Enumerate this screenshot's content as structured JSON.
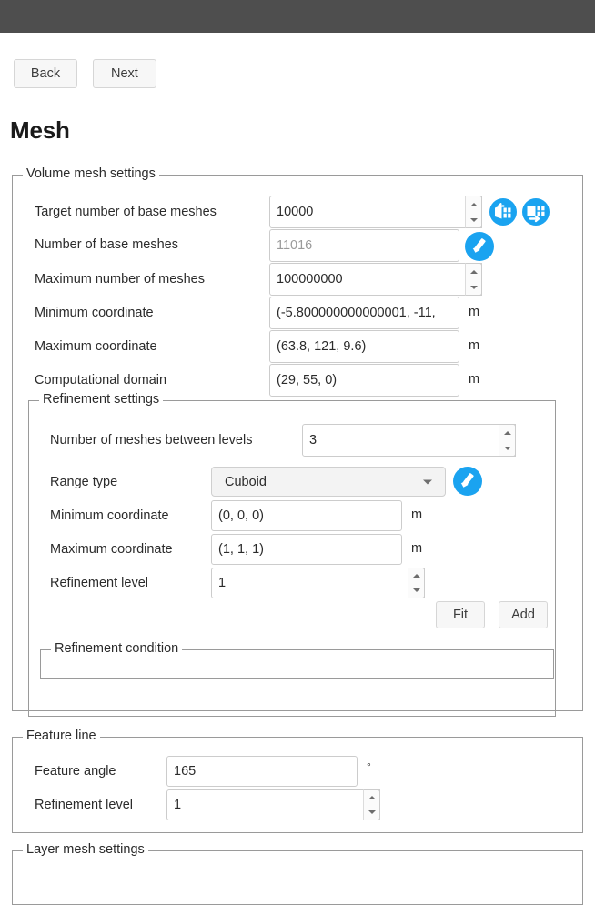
{
  "window": {
    "titlebar_color": "#4e4e4e"
  },
  "nav": {
    "back_label": "Back",
    "next_label": "Next"
  },
  "page": {
    "title": "Mesh"
  },
  "volume_mesh": {
    "legend": "Volume mesh settings",
    "fields": {
      "target_base_meshes": {
        "label": "Target number of base meshes",
        "value": "10000"
      },
      "number_base_meshes": {
        "label": "Number of base meshes",
        "value": "11016"
      },
      "maximum_number_meshes": {
        "label": "Maximum number of meshes",
        "value": "100000000"
      },
      "minimum_coordinate": {
        "label": "Minimum coordinate",
        "value": "(-5.800000000000001, -11,",
        "unit": "m"
      },
      "maximum_coordinate": {
        "label": "Maximum coordinate",
        "value": "(63.8, 121, 9.6)",
        "unit": "m"
      },
      "computational_domain": {
        "label": "Computational domain",
        "value": "(29, 55, 0)",
        "unit": "m"
      }
    },
    "icons": {
      "import_mesh": "import-base-mesh-icon",
      "export_mesh": "export-base-mesh-icon",
      "update_mesh": "update-base-mesh-icon"
    }
  },
  "refinement": {
    "legend": "Refinement settings",
    "fields": {
      "meshes_between_levels": {
        "label": "Number of meshes between levels",
        "value": "3"
      },
      "range_type": {
        "label": "Range type",
        "value": "Cuboid",
        "options": [
          "Cuboid"
        ]
      },
      "minimum_coordinate": {
        "label": "Minimum coordinate",
        "value": "(0, 0, 0)",
        "unit": "m"
      },
      "maximum_coordinate": {
        "label": "Maximum coordinate",
        "value": "(1, 1, 1)",
        "unit": "m"
      },
      "refinement_level": {
        "label": "Refinement level",
        "value": "1"
      }
    },
    "buttons": {
      "fit_label": "Fit",
      "add_label": "Add"
    },
    "icons": {
      "apply_range": "apply-range-icon"
    },
    "condition": {
      "legend": "Refinement condition",
      "items": []
    }
  },
  "feature_line": {
    "legend": "Feature line",
    "fields": {
      "feature_angle": {
        "label": "Feature angle",
        "value": "165",
        "unit": "°"
      },
      "refinement_level": {
        "label": "Refinement level",
        "value": "1"
      }
    }
  },
  "layer_mesh": {
    "legend": "Layer mesh settings"
  },
  "colors": {
    "accent_blue": "#1aa3f0",
    "titlebar": "#4e4e4e",
    "border": "#9a9a9a"
  }
}
